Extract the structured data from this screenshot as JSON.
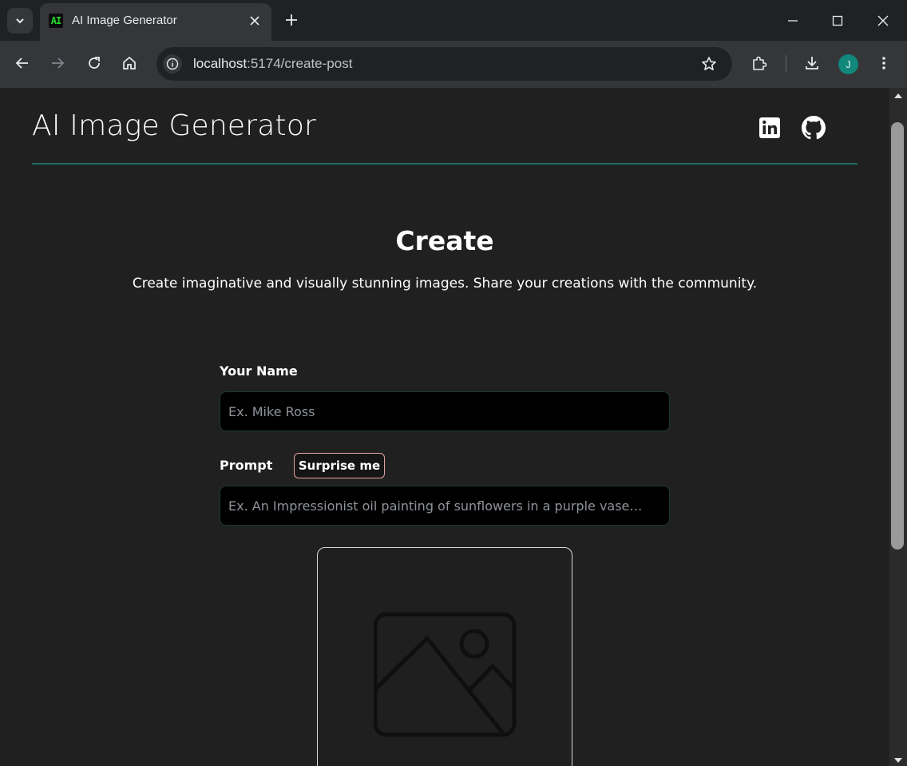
{
  "browser": {
    "tab_title": "AI Image Generator",
    "tab_favicon_text": "AI",
    "url_host": "localhost",
    "url_path": ":5174/create-post",
    "profile_initial": "J"
  },
  "header": {
    "site_title": "AI Image Generator",
    "icons": [
      "linkedin-icon",
      "github-icon"
    ]
  },
  "main": {
    "title": "Create",
    "subtitle": "Create imaginative and visually stunning images. Share your creations with the community."
  },
  "form": {
    "name_label": "Your Name",
    "name_placeholder": "Ex. Mike Ross",
    "name_value": "",
    "prompt_label": "Prompt",
    "surprise_label": "Surprise me",
    "prompt_placeholder": "Ex. An Impressionist oil painting of sunflowers in a purple vase…",
    "prompt_value": ""
  },
  "preview": {
    "icon": "image-placeholder-icon"
  },
  "colors": {
    "page_background": "#202020",
    "header_divider": "#1d6e5e",
    "input_background": "#000000",
    "surprise_border": "#e8a3a3",
    "profile_avatar": "#12877c"
  }
}
